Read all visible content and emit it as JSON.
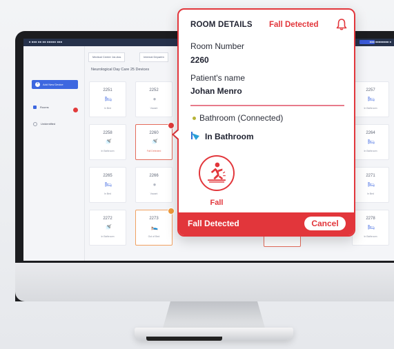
{
  "os_bar": {
    "left_text": "■ ■■■  ■■  ■■  ■■■■■  ■■■",
    "right_text": "■■■  ■■■■■■■■  ■"
  },
  "app": {
    "tabs": [
      "Medical Center 1st-Ass",
      "Internal Departm"
    ],
    "section_title": "Neurological Day Care  25 Devices",
    "add_device_label": "Add New Device",
    "sidebar": [
      {
        "label": "Rooms",
        "type": "checkbox"
      },
      {
        "label": "Unidentified",
        "type": "radio"
      }
    ]
  },
  "cards": [
    {
      "room": "2251",
      "status": "In Bed",
      "icon": "bed-icon",
      "tone": "normal"
    },
    {
      "room": "2252",
      "status": "Vacant",
      "icon": "vacant-icon",
      "tone": "normal"
    },
    {
      "room": "2257",
      "status": "In Bathroom",
      "icon": "bed-icon",
      "tone": "normal"
    },
    {
      "room": "2258",
      "status": "In Bathroom",
      "icon": "bathroom-icon",
      "tone": "normal"
    },
    {
      "room": "2260",
      "status": "Fall Detected",
      "icon": "bathroom-icon",
      "tone": "alert"
    },
    {
      "room": "2264",
      "status": "In Bathroom",
      "icon": "bed-icon",
      "tone": "normal"
    },
    {
      "room": "2265",
      "status": "In Bed",
      "icon": "bed-icon",
      "tone": "normal"
    },
    {
      "room": "2266",
      "status": "Vacant",
      "icon": "vacant-icon",
      "tone": "normal"
    },
    {
      "room": "2271",
      "status": "In Bed",
      "icon": "bed-icon",
      "tone": "normal"
    },
    {
      "room": "2272",
      "status": "In Bathroom",
      "icon": "bathroom-icon",
      "tone": "normal"
    },
    {
      "room": "2273",
      "status": "Out of Bed",
      "icon": "out-of-bed-icon",
      "tone": "warn"
    },
    {
      "room": "2278",
      "status": "In Bathroom",
      "icon": "bed-icon",
      "tone": "normal"
    }
  ],
  "popup": {
    "title": "ROOM DETAILS",
    "status": "Fall Detected",
    "room_number_label": "Room Number",
    "room_number": "2260",
    "patient_label": "Patient's name",
    "patient_name": "Johan Menro",
    "location": "Bathroom (Connected)",
    "presence": "In Bathroom",
    "event_label": "Fall",
    "footer_text": "Fall Detected",
    "cancel_label": "Cancel",
    "accent_color": "#e2363b"
  }
}
